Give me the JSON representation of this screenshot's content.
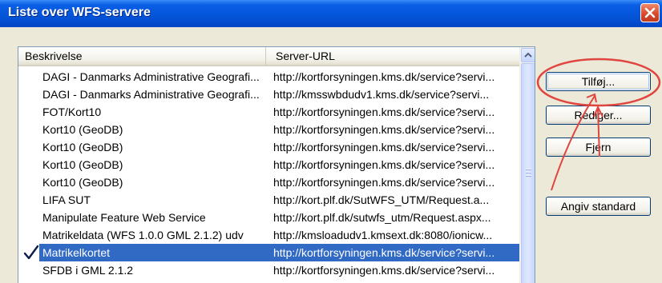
{
  "window": {
    "title": "Liste over WFS-servere",
    "close_icon": "close-icon"
  },
  "list": {
    "columns": [
      "Beskrivelse",
      "Server-URL"
    ],
    "rows": [
      {
        "desc": "DAGI - Danmarks Administrative Geografi...",
        "url": "http://kortforsyningen.kms.dk/service?servi...",
        "checked": false,
        "selected": false
      },
      {
        "desc": "DAGI - Danmarks Administrative Geografi...",
        "url": "http://kmsswbdudv1.kms.dk/service?servi...",
        "checked": false,
        "selected": false
      },
      {
        "desc": "FOT/Kort10",
        "url": "http://kortforsyningen.kms.dk/service?servi...",
        "checked": false,
        "selected": false
      },
      {
        "desc": "Kort10 (GeoDB)",
        "url": "http://kortforsyningen.kms.dk/service?servi...",
        "checked": false,
        "selected": false
      },
      {
        "desc": "Kort10 (GeoDB)",
        "url": "http://kortforsyningen.kms.dk/service?servi...",
        "checked": false,
        "selected": false
      },
      {
        "desc": "Kort10 (GeoDB)",
        "url": "http://kortforsyningen.kms.dk/service?servi...",
        "checked": false,
        "selected": false
      },
      {
        "desc": "Kort10 (GeoDB)",
        "url": "http://kortforsyningen.kms.dk/service?servi...",
        "checked": false,
        "selected": false
      },
      {
        "desc": "LIFA SUT",
        "url": "http://kort.plf.dk/SutWFS_UTM/Request.a...",
        "checked": false,
        "selected": false
      },
      {
        "desc": "Manipulate Feature Web Service",
        "url": "http://kort.plf.dk/sutwfs_utm/Request.aspx...",
        "checked": false,
        "selected": false
      },
      {
        "desc": "Matrikeldata (WFS 1.0.0 GML 2.1.2) udv",
        "url": "http://kmsloadudv1.kmsext.dk:8080/ionicw...",
        "checked": false,
        "selected": false
      },
      {
        "desc": "Matrikelkortet",
        "url": "http://kortforsyningen.kms.dk/service?servi...",
        "checked": true,
        "selected": true
      },
      {
        "desc": "SFDB i GML 2.1.2",
        "url": "http://kortforsyningen.kms.dk/service?servi...",
        "checked": false,
        "selected": false
      }
    ]
  },
  "buttons": {
    "add": "Tilføj...",
    "edit": "Rediger...",
    "remove": "Fjern",
    "set_default": "Angiv standard"
  },
  "colors": {
    "titlebar": "#0454d8",
    "selection": "#316ac5",
    "annotation": "#e0453f"
  }
}
